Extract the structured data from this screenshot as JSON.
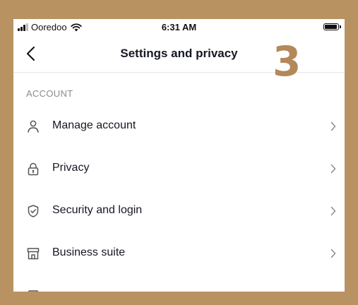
{
  "status_bar": {
    "carrier": "Ooredoo",
    "time": "6:31 AM"
  },
  "nav": {
    "title": "Settings and privacy"
  },
  "overlay": {
    "number": "3",
    "color": "#b3895a"
  },
  "section": {
    "header": "ACCOUNT"
  },
  "items": [
    {
      "label": "Manage account",
      "icon": "person-icon"
    },
    {
      "label": "Privacy",
      "icon": "lock-icon"
    },
    {
      "label": "Security and login",
      "icon": "shield-check-icon"
    },
    {
      "label": "Business suite",
      "icon": "storefront-icon"
    }
  ],
  "colors": {
    "background": "#b99262",
    "text": "#161823",
    "muted": "#8a8b91"
  }
}
